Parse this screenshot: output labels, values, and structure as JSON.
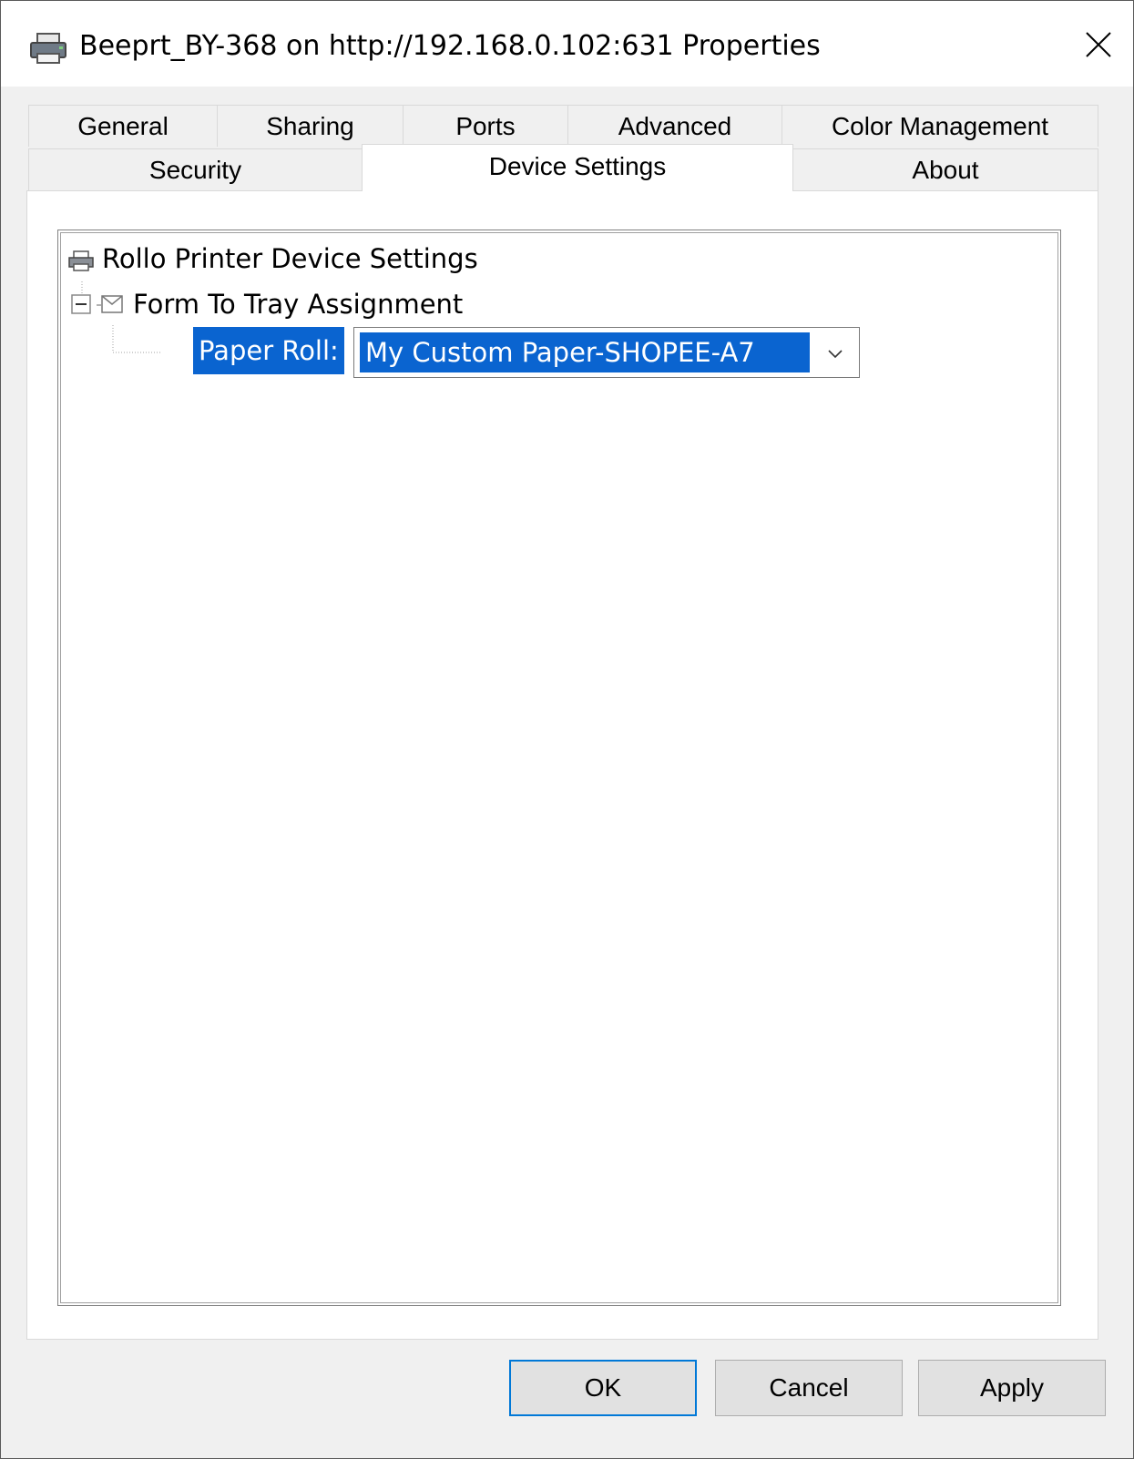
{
  "window": {
    "title": "Beeprt_BY-368 on http://192.168.0.102:631 Properties"
  },
  "tabs": {
    "row1": [
      {
        "label": "General"
      },
      {
        "label": "Sharing"
      },
      {
        "label": "Ports"
      },
      {
        "label": "Advanced"
      },
      {
        "label": "Color Management"
      }
    ],
    "row2": [
      {
        "label": "Security"
      },
      {
        "label": "Device Settings",
        "active": true
      },
      {
        "label": "About"
      }
    ]
  },
  "tree": {
    "root_label": "Rollo Printer Device Settings",
    "group_label": "Form To Tray Assignment",
    "setting_label": "Paper Roll:",
    "setting_value": "My Custom Paper-SHOPEE-A7"
  },
  "buttons": {
    "ok": "OK",
    "cancel": "Cancel",
    "apply": "Apply"
  },
  "colors": {
    "selection": "#0a64d0",
    "default_button_border": "#0078d7"
  }
}
